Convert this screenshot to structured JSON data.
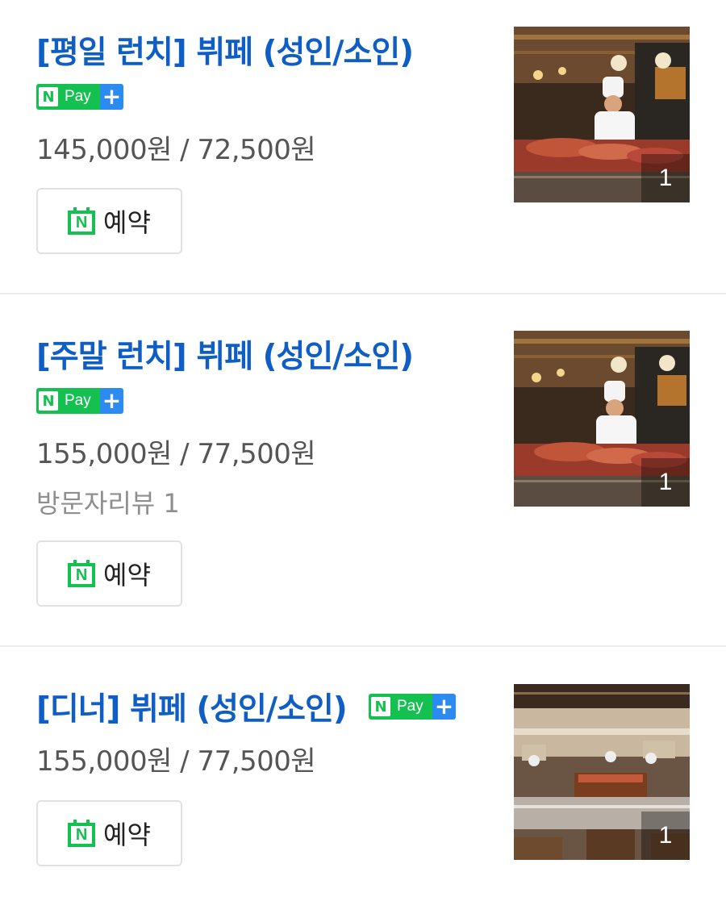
{
  "items": [
    {
      "title": "[평일 런치] 뷔페 (성인/소인)",
      "price": "145,000원 / 72,500원",
      "npay": {
        "n": "N",
        "pay": "Pay",
        "plus": "+"
      },
      "reserve_label": "예약",
      "reserve_icon": "naver-booking-calendar-icon",
      "photo_count": "1"
    },
    {
      "title": "[주말 런치] 뷔페 (성인/소인)",
      "price": "155,000원 / 77,500원",
      "review": "방문자리뷰 1",
      "npay": {
        "n": "N",
        "pay": "Pay",
        "plus": "+"
      },
      "reserve_label": "예약",
      "reserve_icon": "naver-booking-calendar-icon",
      "photo_count": "1"
    },
    {
      "title": "[디너] 뷔페 (성인/소인)",
      "price": "155,000원 / 77,500원",
      "npay": {
        "n": "N",
        "pay": "Pay",
        "plus": "+"
      },
      "reserve_label": "예약",
      "reserve_icon": "naver-booking-calendar-icon",
      "photo_count": "1"
    }
  ],
  "colors": {
    "title": "#0f5ec5",
    "npay_green": "#14c050",
    "npay_blue": "#2c8bf0",
    "price": "#555555",
    "divider": "#ececec"
  }
}
